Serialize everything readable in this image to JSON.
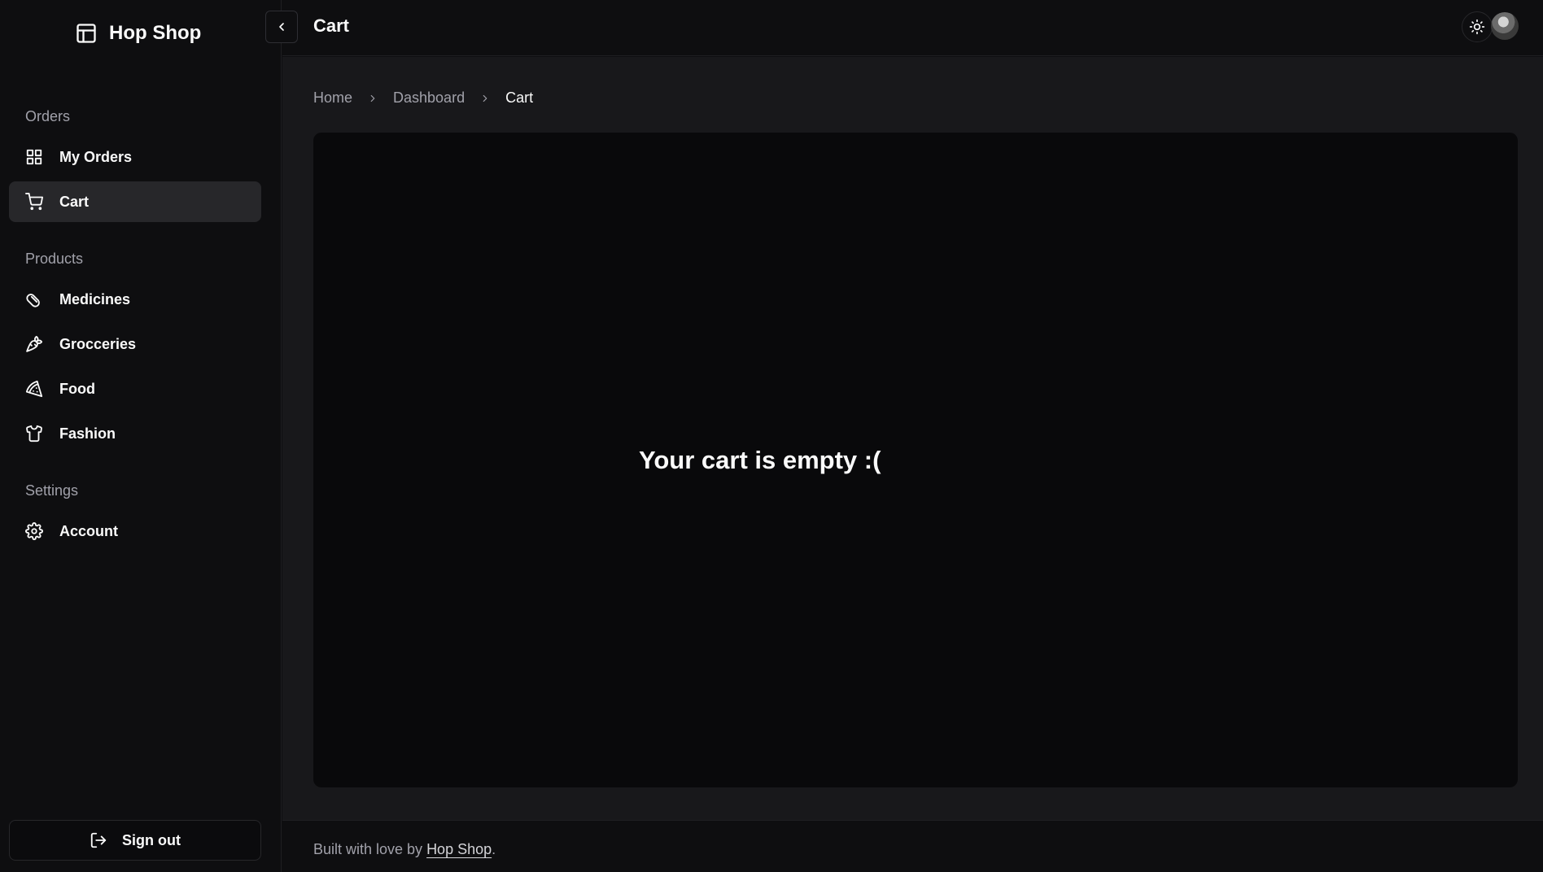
{
  "app": {
    "brand": "Hop Shop"
  },
  "sidebar": {
    "sections": {
      "orders": "Orders",
      "products": "Products",
      "settings": "Settings"
    },
    "items": {
      "my_orders": "My Orders",
      "cart": "Cart",
      "medicines": "Medicines",
      "groceries": "Grocceries",
      "food": "Food",
      "fashion": "Fashion",
      "account": "Account"
    },
    "active": "cart",
    "sign_out": "Sign out"
  },
  "header": {
    "title": "Cart"
  },
  "breadcrumb": [
    "Home",
    "Dashboard",
    "Cart"
  ],
  "main": {
    "empty_message": "Your cart is empty :("
  },
  "footer": {
    "prefix": "Built with love by ",
    "link": "Hop Shop",
    "suffix": "."
  },
  "icons": {
    "brand": "layout-icon",
    "my_orders": "grid-icon",
    "cart": "cart-icon",
    "medicines": "pill-icon",
    "groceries": "carrot-icon",
    "food": "pizza-icon",
    "fashion": "shirt-icon",
    "account": "gear-icon",
    "sign_out": "logout-icon",
    "theme": "sun-icon",
    "collapse": "chevron-left-icon"
  }
}
